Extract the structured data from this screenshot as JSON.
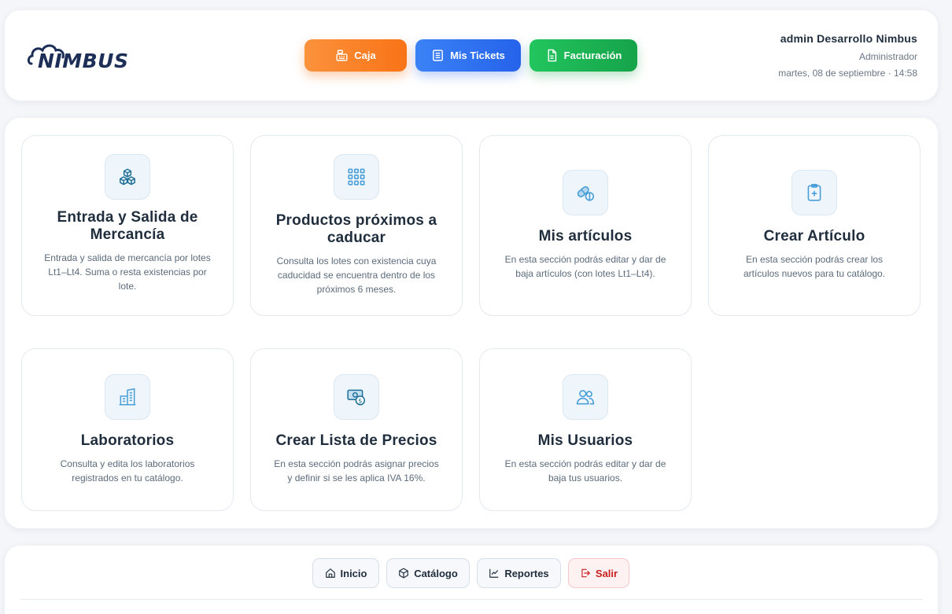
{
  "header": {
    "logo_text": "NIMBUS",
    "nav": {
      "caja": "Caja",
      "tickets": "Mis Tickets",
      "facturacion": "Facturación"
    },
    "user": {
      "name": "admin Desarrollo Nimbus",
      "role": "Administrador",
      "datetime": "martes, 08 de septiembre · 14:58"
    }
  },
  "cards": [
    {
      "icon": "cubes-icon",
      "title": "Entrada y Salida de Mercancía",
      "desc": "Entrada y salida de mercancía por lotes Lt1–Lt4. Suma o resta existencias por lote."
    },
    {
      "icon": "grid-icon",
      "title": "Productos próximos a caducar",
      "desc": "Consulta los lotes con existencia cuya caducidad se encuentra dentro de los próximos 6 meses."
    },
    {
      "icon": "pill-icon",
      "title": "Mis artículos",
      "desc": "En esta sección podrás editar y dar de baja artículos (con lotes Lt1–Lt4)."
    },
    {
      "icon": "clipboard-plus-icon",
      "title": "Crear Artículo",
      "desc": "En esta sección podrás crear los artículos nuevos para tu catálogo."
    },
    {
      "icon": "building-icon",
      "title": "Laboratorios",
      "desc": "Consulta y edita los laboratorios registrados en tu catálogo."
    },
    {
      "icon": "money-icon",
      "title": "Crear Lista de Precios",
      "desc": "En esta sección podrás asignar precios y definir si se les aplica IVA 16%."
    },
    {
      "icon": "users-icon",
      "title": "Mis Usuarios",
      "desc": "En esta sección podrás editar y dar de baja tus usuarios."
    }
  ],
  "footer": {
    "inicio": "Inicio",
    "catalogo": "Catálogo",
    "reportes": "Reportes",
    "salir": "Salir"
  },
  "colors": {
    "caja": "#f97316",
    "tickets": "#2563eb",
    "facturacion": "#16a34a",
    "icon": "#4a9fd8",
    "salir": "#c81e1e"
  }
}
